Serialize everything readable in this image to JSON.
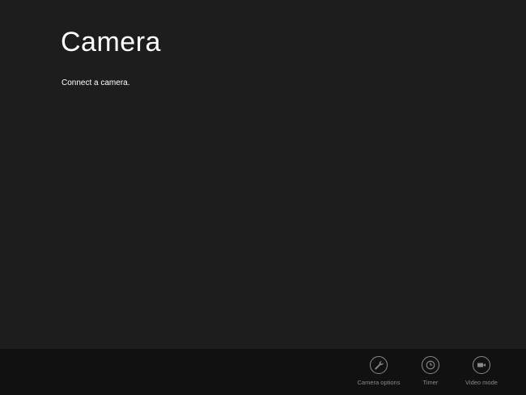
{
  "page": {
    "title": "Camera",
    "message": "Connect a camera."
  },
  "app_bar": {
    "buttons": [
      {
        "label": "Camera options",
        "icon": "wrench-icon"
      },
      {
        "label": "Timer",
        "icon": "clock-icon"
      },
      {
        "label": "Video mode",
        "icon": "video-camera-icon"
      }
    ]
  },
  "colors": {
    "background": "#1d1d1d",
    "app_bar_background": "#111111",
    "icon_gray": "#8a8a8a",
    "text_white": "#ffffff"
  }
}
